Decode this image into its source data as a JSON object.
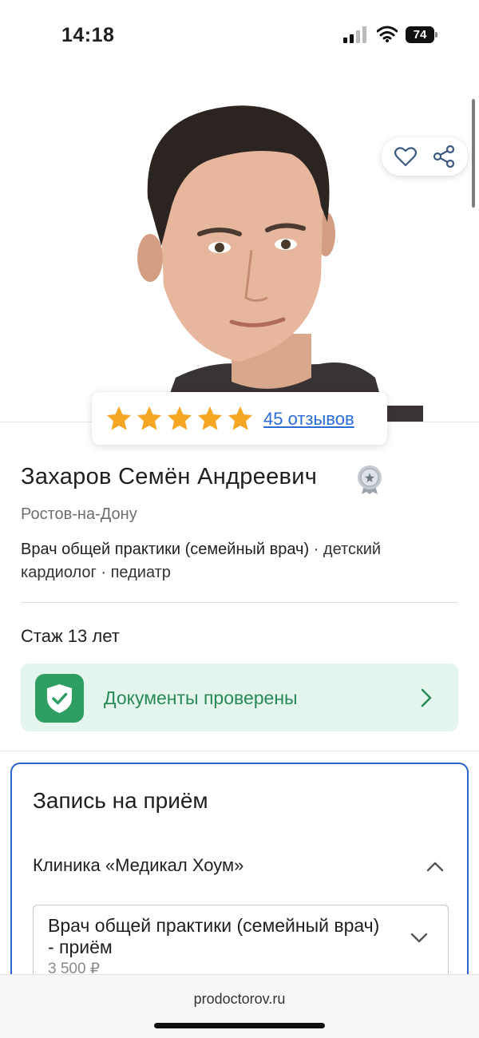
{
  "status_bar": {
    "time": "14:18",
    "battery": "74"
  },
  "hero": {
    "actions": [
      "heart-icon",
      "share-icon"
    ]
  },
  "rating": {
    "stars": 5,
    "reviews_link": "45 отзывов",
    "star_color": "#f5a623"
  },
  "doctor": {
    "name": "Захаров Семён Андреевич",
    "city": "Ростов-на-Дону",
    "specialty_main": "Врач общей практики (семейный врач)",
    "specialty_rest": " · детский кардиолог · педиатр",
    "experience": "Стаж 13 лет"
  },
  "verification": {
    "label": "Документы проверены",
    "color": "#2f9e63"
  },
  "booking": {
    "title": "Запись на приём",
    "clinic": "Клиника «Медикал Хоум»",
    "service": {
      "name": "Врач общей практики (семейный врач) - приём",
      "price": "3 500 ₽"
    },
    "accent": "#2a62c9"
  },
  "browser": {
    "url": "prodoctorov.ru"
  }
}
